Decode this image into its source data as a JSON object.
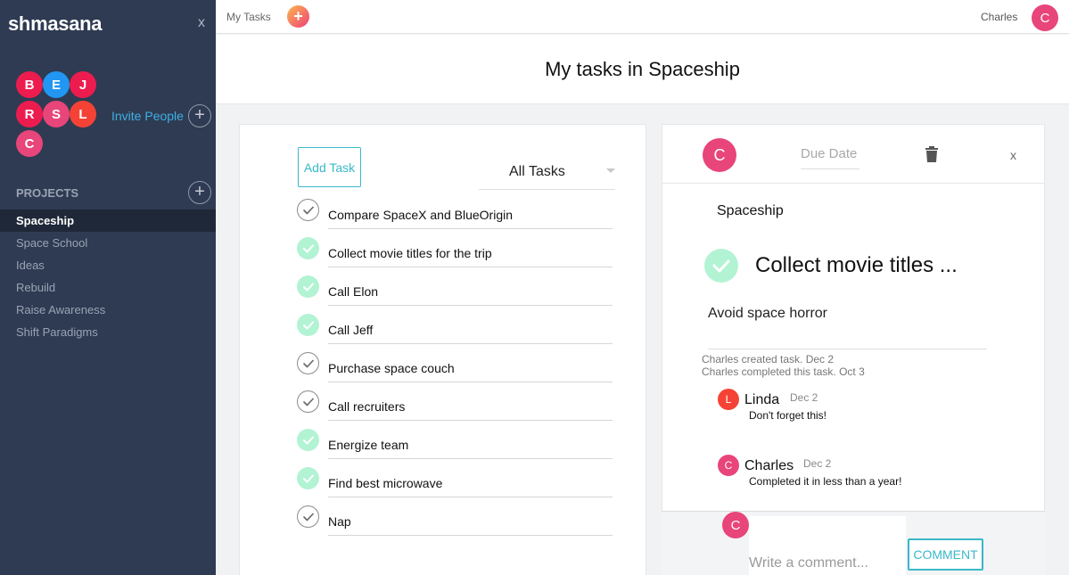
{
  "sidebar": {
    "brand": "shmasana",
    "close_label": "x",
    "members": [
      {
        "initial": "B",
        "color": "#ec1c4f"
      },
      {
        "initial": "E",
        "color": "#2196f3"
      },
      {
        "initial": "J",
        "color": "#ec1c4f"
      },
      {
        "initial": "R",
        "color": "#ec1c4f"
      },
      {
        "initial": "S",
        "color": "#e8457a"
      },
      {
        "initial": "L",
        "color": "#f44336"
      },
      {
        "initial": "C",
        "color": "#e8457a"
      }
    ],
    "invite_label": "Invite People",
    "plus_glyph": "+",
    "projects_heading": "PROJECTS",
    "projects": [
      {
        "label": "Spaceship",
        "active": true
      },
      {
        "label": "Space School",
        "active": false
      },
      {
        "label": "Ideas",
        "active": false
      },
      {
        "label": "Rebuild",
        "active": false
      },
      {
        "label": "Raise Awareness",
        "active": false
      },
      {
        "label": "Shift Paradigms",
        "active": false
      }
    ]
  },
  "topbar": {
    "my_tasks_label": "My Tasks",
    "add_glyph": "+",
    "user_name": "Charles",
    "user_initial": "C"
  },
  "header": {
    "title": "My tasks in Spaceship"
  },
  "tasks_panel": {
    "add_task_label": "Add Task",
    "filter_label": "All Tasks",
    "tasks": [
      {
        "title": "Compare SpaceX and BlueOrigin",
        "completed": false
      },
      {
        "title": "Collect movie titles for the trip",
        "completed": true
      },
      {
        "title": "Call Elon",
        "completed": true
      },
      {
        "title": "Call Jeff",
        "completed": true
      },
      {
        "title": "Purchase space couch",
        "completed": false
      },
      {
        "title": "Call recruiters",
        "completed": false
      },
      {
        "title": "Energize team",
        "completed": true
      },
      {
        "title": "Find best microwave",
        "completed": true
      },
      {
        "title": "Nap",
        "completed": false
      }
    ]
  },
  "detail": {
    "assignee_initial": "C",
    "due_date_placeholder": "Due Date",
    "close_label": "x",
    "project": "Spaceship",
    "title": "Collect movie titles ...",
    "description": "Avoid space horror",
    "activity": [
      "Charles created task. Dec 2",
      "Charles completed this task. Oct 3"
    ],
    "comments": [
      {
        "initial": "L",
        "author": "Linda",
        "date": "Dec 2",
        "text": "Don't forget this!",
        "color": "#f44336"
      },
      {
        "initial": "C",
        "author": "Charles",
        "date": "Dec 2",
        "text": "Completed it in less than a year!",
        "color": "#e8457a"
      }
    ],
    "composer": {
      "avatar_initial": "C",
      "placeholder": "Write a comment...",
      "button_label": "COMMENT"
    }
  },
  "colors": {
    "sidebar_bg": "#2f3b52",
    "accent": "#39b8c9",
    "link": "#3db0e6",
    "done_check": "#b2f3d4",
    "avatar_pink": "#e8457a"
  }
}
